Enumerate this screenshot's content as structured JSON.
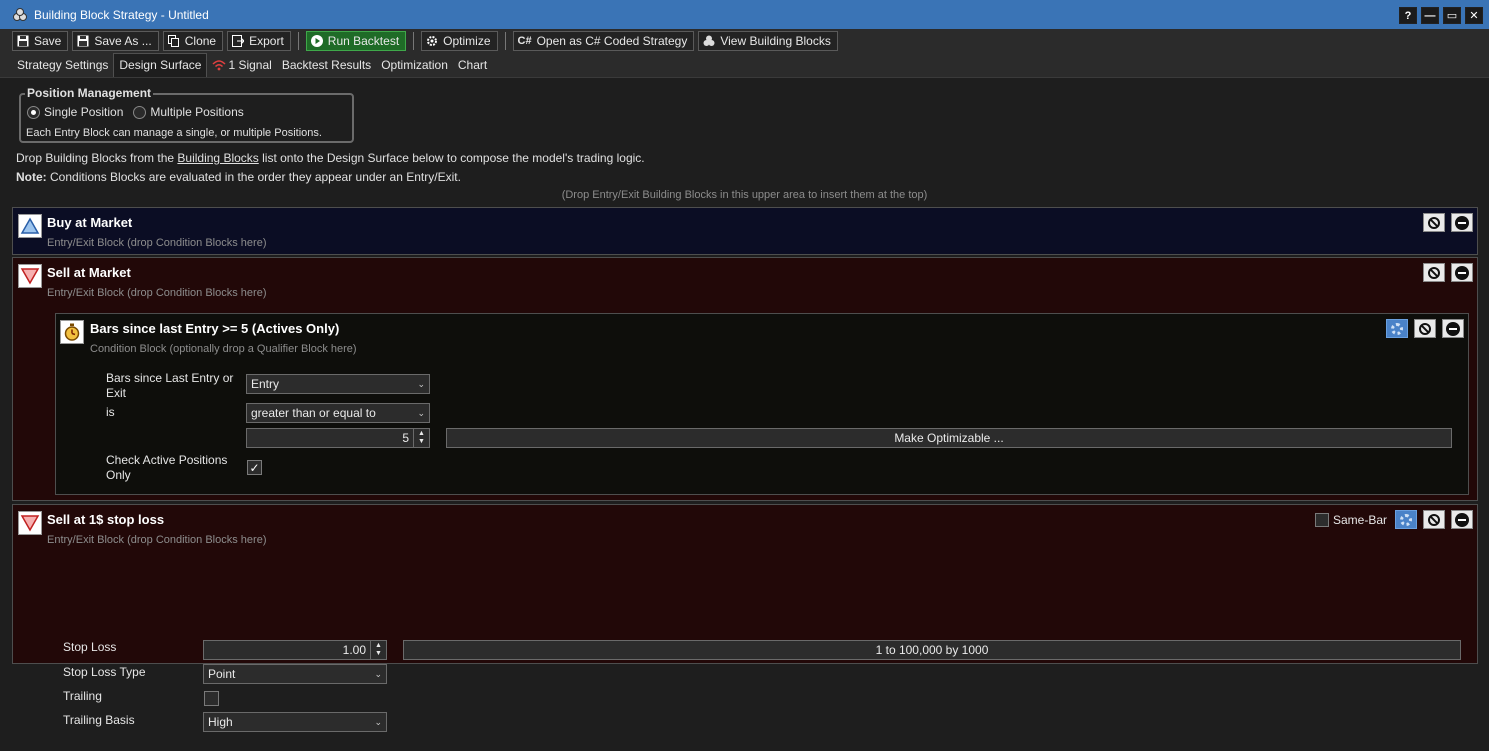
{
  "window": {
    "title": "Building Block Strategy - Untitled",
    "buttons": {
      "help": "?",
      "minimize": "—",
      "maximize": "▭",
      "close": "✕"
    }
  },
  "toolbar": {
    "save": "Save",
    "save_as": "Save As ...",
    "clone": "Clone",
    "export": "Export",
    "run_backtest": "Run Backtest",
    "optimize": "Optimize",
    "open_csharp": "Open as C# Coded Strategy",
    "csharp_icon": "C#",
    "view_blocks": "View Building Blocks"
  },
  "tabs": {
    "strategy_settings": "Strategy Settings",
    "design_surface": "Design Surface",
    "signal": "1 Signal",
    "backtest_results": "Backtest Results",
    "optimization": "Optimization",
    "chart": "Chart",
    "active": "Design Surface"
  },
  "position_management": {
    "title": "Position Management",
    "single": "Single Position",
    "multiple": "Multiple Positions",
    "selected": "Single Position",
    "description": "Each Entry Block can manage a single, or multiple Positions."
  },
  "info": {
    "line1_pre": "Drop Building Blocks from the ",
    "line1_link": "Building Blocks",
    "line1_post": " list onto the Design Surface below to compose the model's trading logic.",
    "note_label": "Note:",
    "note_text": " Conditions Blocks are evaluated in the order they appear under an Entry/Exit.",
    "drop_hint": "(Drop Entry/Exit Building Blocks in this upper area to insert them at the top)"
  },
  "blocks": {
    "buy": {
      "title": "Buy at Market",
      "subtitle": "Entry/Exit Block (drop Condition Blocks here)"
    },
    "sell": {
      "title": "Sell at Market",
      "subtitle": "Entry/Exit Block (drop Condition Blocks here)"
    },
    "condition": {
      "title": "Bars since last Entry >= 5 (Actives Only)",
      "subtitle": "Condition Block (optionally drop a Qualifier Block here)",
      "label_bars": "Bars since Last Entry or Exit",
      "bars_value": "Entry",
      "label_is": "is",
      "comparison_value": "greater than or equal to",
      "number_value": "5",
      "make_optimizable": "Make Optimizable ...",
      "label_check": "Check Active Positions Only",
      "check_value": "✓"
    },
    "stop": {
      "title": "Sell at 1$ stop loss",
      "subtitle": "Entry/Exit Block (drop Condition Blocks here)",
      "same_bar": "Same-Bar",
      "label_stop_loss": "Stop Loss",
      "stop_loss_value": "1.00",
      "opt_range": "1 to 100,000 by 1000",
      "label_type": "Stop Loss Type",
      "type_value": "Point",
      "label_trailing": "Trailing",
      "label_basis": "Trailing Basis",
      "basis_value": "High"
    }
  },
  "icons": {
    "app": "building-blocks-icon",
    "buy": "triangle-up-icon",
    "sell": "triangle-down-icon",
    "condition": "stopwatch-icon"
  },
  "colors": {
    "titlebar": "#3a74b6",
    "buy_block": "#0b0d24",
    "sell_block": "#220808",
    "run_backtest": "#1f6b27"
  }
}
